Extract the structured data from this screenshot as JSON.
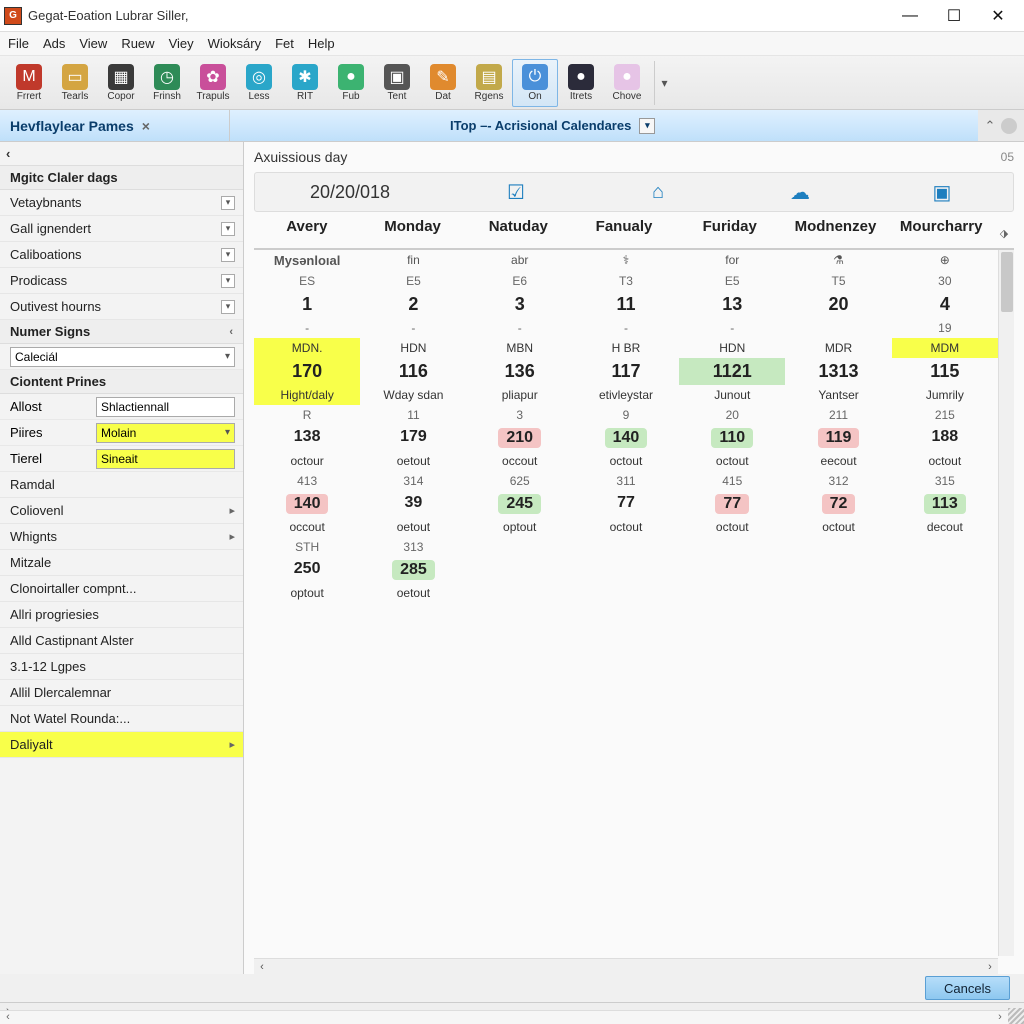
{
  "window": {
    "title": "Gegat-Eoation Lubrar Siller,"
  },
  "menu": [
    "File",
    "Ads",
    "View",
    "Ruew",
    "Viey",
    "Wioksáry",
    "Fet",
    "Help"
  ],
  "toolbar": [
    {
      "icon": "#c0392b",
      "glyph": "M",
      "label": "Frrert"
    },
    {
      "icon": "#d4a542",
      "glyph": "▭",
      "label": "Tearls"
    },
    {
      "icon": "#3a3a3a",
      "glyph": "▦",
      "label": "Copor"
    },
    {
      "icon": "#2e8b57",
      "glyph": "◷",
      "label": "Frinsh"
    },
    {
      "icon": "#c94f9a",
      "glyph": "✿",
      "label": "Trapuls"
    },
    {
      "icon": "#2aa6c9",
      "glyph": "◎",
      "label": "Less"
    },
    {
      "icon": "#2aa6c9",
      "glyph": "✱",
      "label": "RIT"
    },
    {
      "icon": "#3cb371",
      "glyph": "●",
      "label": "Fub"
    },
    {
      "icon": "#555",
      "glyph": "▣",
      "label": "Tent"
    },
    {
      "icon": "#e08a2e",
      "glyph": "✎",
      "label": "Dat"
    },
    {
      "icon": "#c2a94a",
      "glyph": "▤",
      "label": "Rgens"
    },
    {
      "icon": "#4a90d9",
      "glyph": "⏻",
      "label": "On",
      "active": true
    },
    {
      "icon": "#2b2b3a",
      "glyph": "●",
      "label": "Itrets"
    },
    {
      "icon": "#e6c4e6",
      "glyph": "●",
      "label": "Chove"
    }
  ],
  "tabs": {
    "left": "Hevflaylear Pames",
    "main": "ITop –- Acrisional Calendares"
  },
  "sidebar": {
    "top_label": "‹",
    "section1": "Mgitc Claler dags",
    "items1": [
      "Vetaybnants",
      "Gall ignendert",
      "Caliboations",
      "Prodicass",
      "Outivest hourns"
    ],
    "section2": "Numer Signs",
    "dropdown2": "Caleciál",
    "section3": "Ciontent Prines",
    "rows": [
      {
        "label": "Allost",
        "value": "Shlactiennall",
        "yellow": false
      },
      {
        "label": "Piires",
        "value": "Molain",
        "yellow": true,
        "dd": true
      },
      {
        "label": "Tierel",
        "value": "Sineait",
        "yellow": true
      }
    ],
    "items2": [
      "Ramdal",
      "Coliovenl",
      "Whignts",
      "Mitzale",
      "Clonoirtaller compnt...",
      "Allri progriesies",
      "Alld Castipnant Alster",
      "3.1-12 Lgpes",
      "Allil Dlercalemnar",
      "Not Watel Rounda:...",
      "Daliyalt"
    ]
  },
  "main": {
    "header": "Axuissious day",
    "header_right": "05",
    "date": "20/20/018",
    "day_headers": [
      "Avery",
      "Monday",
      "Natuday",
      "Fanualy",
      "Furiday",
      "Modnenzey",
      "Mourcharry"
    ],
    "row_sub1": [
      "Mysənloıal",
      "fin",
      "abr",
      "⚕",
      "for",
      "⚗",
      "⊕"
    ],
    "row_e": [
      "ES",
      "E5",
      "E6",
      "T3",
      "E5",
      "T5",
      "30"
    ],
    "row_n1": [
      "1",
      "2",
      "3",
      "11",
      "13",
      "20",
      "4"
    ],
    "row_dash": [
      "-",
      "-",
      "-",
      "-",
      "-",
      "",
      "19"
    ],
    "row_code": [
      "MDN.",
      "HDN",
      "MBN",
      "H BR",
      "HDN",
      "MDR",
      "MDM"
    ],
    "row_big": [
      "170",
      "116",
      "136",
      "117",
      "1121",
      "1313",
      "115"
    ],
    "row_lbl1": [
      "Hight/daly",
      "Wday sdan",
      "pliapur",
      "etivleystar",
      "Junout",
      "Yantser",
      "Jumrily"
    ],
    "row_r": [
      "R",
      "11",
      "3",
      "9",
      "20",
      "211",
      "215"
    ],
    "row_n2": [
      "138",
      "179",
      "210",
      "140",
      "110",
      "119",
      "188"
    ],
    "row_lbl2": [
      "octour",
      "oetout",
      "occout",
      "octout",
      "octout",
      "eecout",
      "octout"
    ],
    "row_s3": [
      "413",
      "314",
      "625",
      "311",
      "415",
      "312",
      "315"
    ],
    "row_n3": [
      "140",
      "39",
      "245",
      "77",
      "77",
      "72",
      "113"
    ],
    "row_lbl3": [
      "occout",
      "oetout",
      "optout",
      "octout",
      "octout",
      "octout",
      "decout"
    ],
    "row_s4": [
      "STH",
      "313",
      "",
      "",
      "",
      "",
      ""
    ],
    "row_n4": [
      "250",
      "285",
      "",
      "",
      "",
      "",
      ""
    ],
    "row_lbl4": [
      "optout",
      "oetout",
      "",
      "",
      "",
      "",
      ""
    ],
    "highlights": {
      "code": [
        {
          "i": 0,
          "c": "hly"
        },
        {
          "i": 6,
          "c": "hly"
        }
      ],
      "big": [
        {
          "i": 0,
          "c": "hly"
        },
        {
          "i": 4,
          "c": "hlg"
        }
      ],
      "lbl1": [
        {
          "i": 0,
          "c": "hly"
        }
      ],
      "n2": [
        {
          "i": 2,
          "c": "hlp"
        },
        {
          "i": 3,
          "c": "hlg"
        },
        {
          "i": 4,
          "c": "hlg"
        },
        {
          "i": 5,
          "c": "hlp"
        }
      ],
      "n3": [
        {
          "i": 0,
          "c": "hlp"
        },
        {
          "i": 2,
          "c": "hlg"
        },
        {
          "i": 4,
          "c": "hlp"
        },
        {
          "i": 5,
          "c": "hlp"
        },
        {
          "i": 6,
          "c": "hlg"
        }
      ],
      "n4": [
        {
          "i": 1,
          "c": "hlg"
        }
      ]
    }
  },
  "buttons": {
    "cancel": "Cancels"
  }
}
